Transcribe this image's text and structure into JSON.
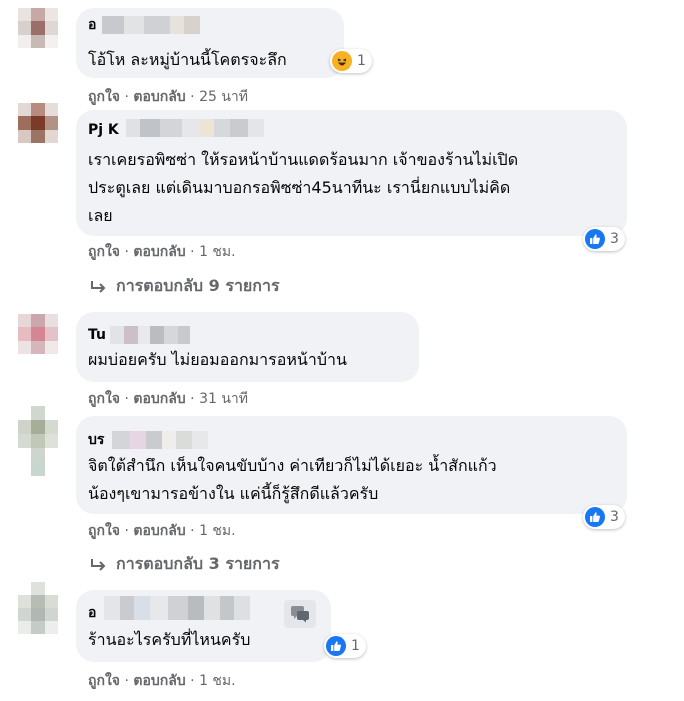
{
  "comments": [
    {
      "name": "อ",
      "text": "โอ้โห ละหมู่บ้านนี้โคตรจะลึก",
      "like": "ถูกใจ",
      "reply": "ตอบกลับ",
      "time": "25 นาที",
      "reaction": {
        "type": "haha-icon",
        "count": "1"
      }
    },
    {
      "name": "Pj K",
      "text": "เราเคยรอพิซซ่า ให้รอหน้าบ้านแดดร้อนมาก เจ้าของร้านไม่เปิด\nประตูเลย แต่เดินมาบอกรอพิซซ่า45นาทีนะ เรานี่ยกแบบไม่คิด\nเลย",
      "like": "ถูกใจ",
      "reply": "ตอบกลับ",
      "time": "1 ชม.",
      "reaction": {
        "type": "like-icon",
        "count": "3"
      },
      "replies": "การตอบกลับ 9 รายการ"
    },
    {
      "name": "Tu",
      "text": "ผมบ่อยครับ ไม่ยอมออกมารอหน้าบ้าน",
      "like": "ถูกใจ",
      "reply": "ตอบกลับ",
      "time": "31 นาที"
    },
    {
      "name": "บร",
      "text": "จิตใต้สำนึก เห็นใจคนขับบ้าง ค่าเทียวก็ไม่ได้เยอะ น้ำสักแก้ว\nน้องๆเขามารอข้างใน แค่นี้ก็รู้สึกดีแล้วครับ",
      "like": "ถูกใจ",
      "reply": "ตอบกลับ",
      "time": "1 ชม.",
      "reaction": {
        "type": "like-icon",
        "count": "3"
      },
      "replies": "การตอบกลับ 3 รายการ"
    },
    {
      "name": "อ",
      "text": "ร้านอะไรครับที่ไหนครับ",
      "like": "ถูกใจ",
      "reply": "ตอบกลับ",
      "time": "1 ชม.",
      "reaction": {
        "type": "like-icon",
        "count": "1"
      }
    }
  ],
  "separator": "·",
  "colors": {
    "like_blue": "#1877f2",
    "haha_yellow": "#f7b125",
    "meta_gray": "#65676b",
    "bubble": "#f0f2f5"
  }
}
